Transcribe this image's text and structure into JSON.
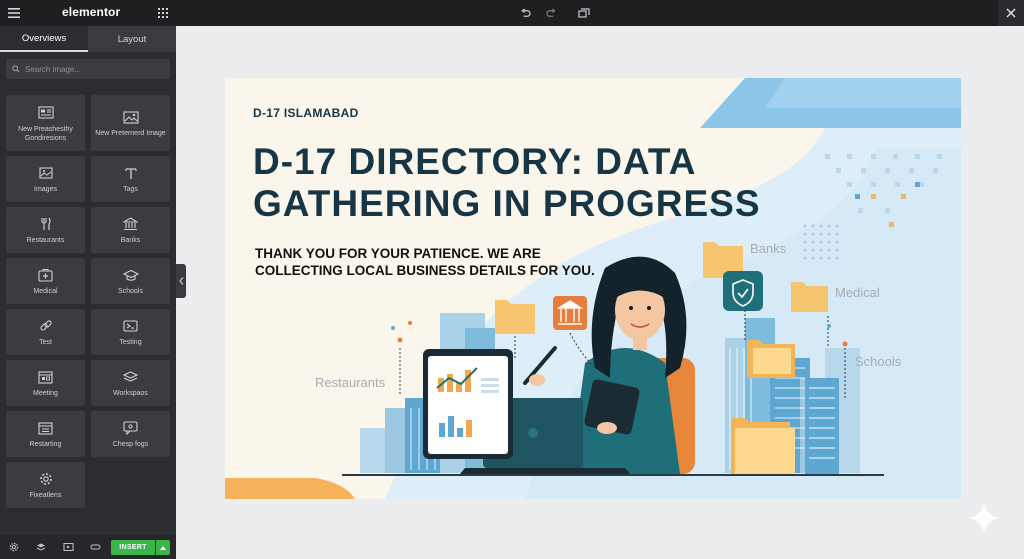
{
  "app": {
    "brand": "elementor"
  },
  "sidebar": {
    "tabs": [
      {
        "label": "Overviews",
        "active": true
      },
      {
        "label": "Layout",
        "active": false
      }
    ],
    "search_placeholder": "Search image...",
    "widgets": [
      {
        "label": "New Preashesthy Gondiresions",
        "icon": "layout-icon"
      },
      {
        "label": "New Preternerd Image",
        "icon": "image-icon"
      },
      {
        "label": "Images",
        "icon": "images-icon"
      },
      {
        "label": "Tags",
        "icon": "text-icon"
      },
      {
        "label": "Restaurants",
        "icon": "fork-knife-icon"
      },
      {
        "label": "Banks",
        "icon": "bank-icon"
      },
      {
        "label": "Medical",
        "icon": "medical-icon"
      },
      {
        "label": "Schools",
        "icon": "graduation-cap-icon"
      },
      {
        "label": "Test",
        "icon": "link-icon"
      },
      {
        "label": "Testing",
        "icon": "tag-icon"
      },
      {
        "label": "Meeting",
        "icon": "calendar-icon"
      },
      {
        "label": "Workspaos",
        "icon": "layers-icon"
      },
      {
        "label": "Restarting",
        "icon": "calendar-grid-icon"
      },
      {
        "label": "Chesp fogs",
        "icon": "chat-icon"
      },
      {
        "label": "Fixeatlens",
        "icon": "gear-icon"
      }
    ],
    "insert_label": "INSERT"
  },
  "banner": {
    "location": "D-17 ISLAMABAD",
    "title": "D-17 DIRECTORY: DATA GATHERING IN PROGRESS",
    "subtitle": "THANK YOU FOR YOUR PATIENCE. WE ARE COLLECTING LOCAL BUSINESS DETAILS FOR YOU.",
    "labels": {
      "banks": "Banks",
      "medical": "Medical",
      "schools": "Schools",
      "restaurants": "Restaurants"
    }
  },
  "colors": {
    "topbar": "#1e1f21",
    "sidebar": "#2c2d30",
    "insert_green": "#39b54a",
    "banner_bg": "#fbf6ec",
    "title_navy": "#163545",
    "teal": "#1f6f7a",
    "orange": "#f0a850"
  }
}
